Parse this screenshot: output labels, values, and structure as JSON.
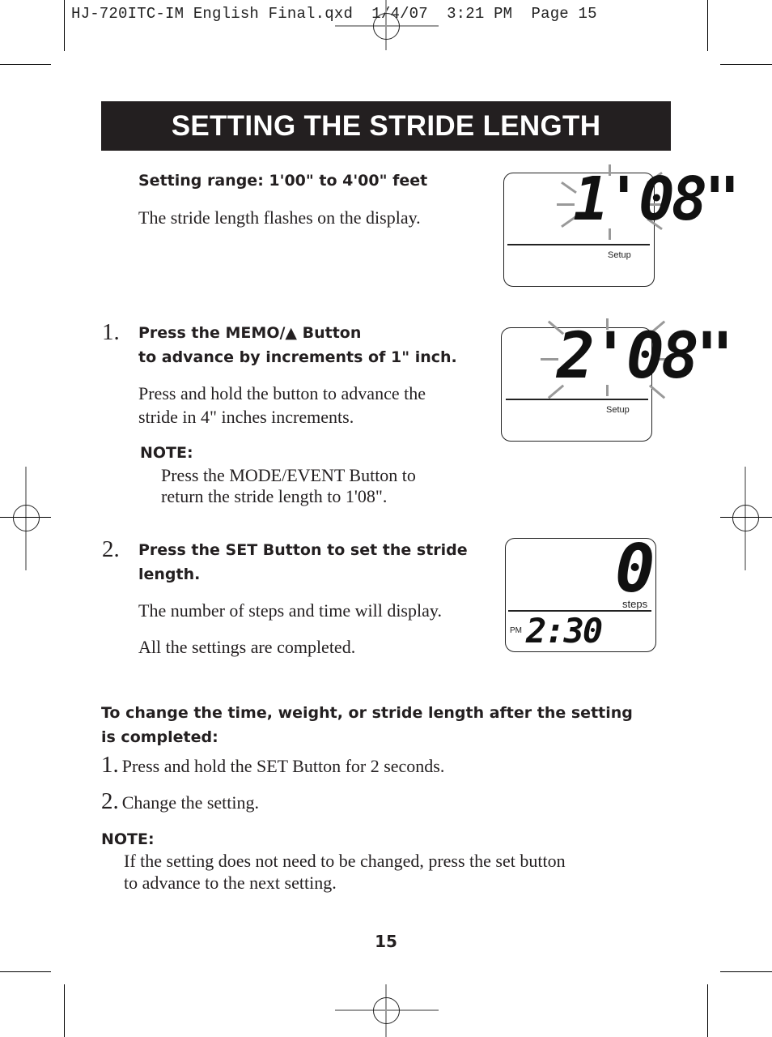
{
  "slug": "HJ-720ITC-IM English Final.qxd  1/4/07  3:21 PM  Page 15",
  "title": "SETTING THE STRIDE LENGTH",
  "intro": {
    "range": "Setting range: 1'00\" to 4'00\" feet",
    "flash_text": "The stride length flashes on the display."
  },
  "steps": [
    {
      "number": "1.",
      "heading_line1": "Press the MEMO/▲ Button",
      "heading_line2": "to advance by increments of 1\" inch.",
      "body_line1": "Press and hold the button to advance the",
      "body_line2": "stride in 4\" inches increments.",
      "note_label": "NOTE:",
      "note_line1": "Press the MODE/EVENT Button to",
      "note_line2": "return the stride length to 1'08\"."
    },
    {
      "number": "2.",
      "heading_line1": "Press the SET Button to set the stride",
      "heading_line2": "length.",
      "body_line1": "The number of steps and time will display.",
      "body_line2": "All the settings are completed."
    }
  ],
  "change": {
    "heading_line1": "To change the time, weight, or stride length after the setting",
    "heading_line2": "is completed:",
    "items": [
      {
        "number": "1.",
        "text": "Press and hold the SET Button for 2 seconds."
      },
      {
        "number": "2.",
        "text": "Change the setting."
      }
    ],
    "note_label": "NOTE:",
    "note_line1": "If the setting does not need to be changed, press the set button",
    "note_line2": "to advance to the next setting."
  },
  "displays": [
    {
      "value": "1'08\"",
      "label": "Setup",
      "flashing": true
    },
    {
      "value": "2'08\"",
      "label": "Setup",
      "flashing": true
    },
    {
      "value": "0",
      "label": "steps",
      "ampm": "PM",
      "time": "2:30"
    }
  ],
  "page_number": "15"
}
